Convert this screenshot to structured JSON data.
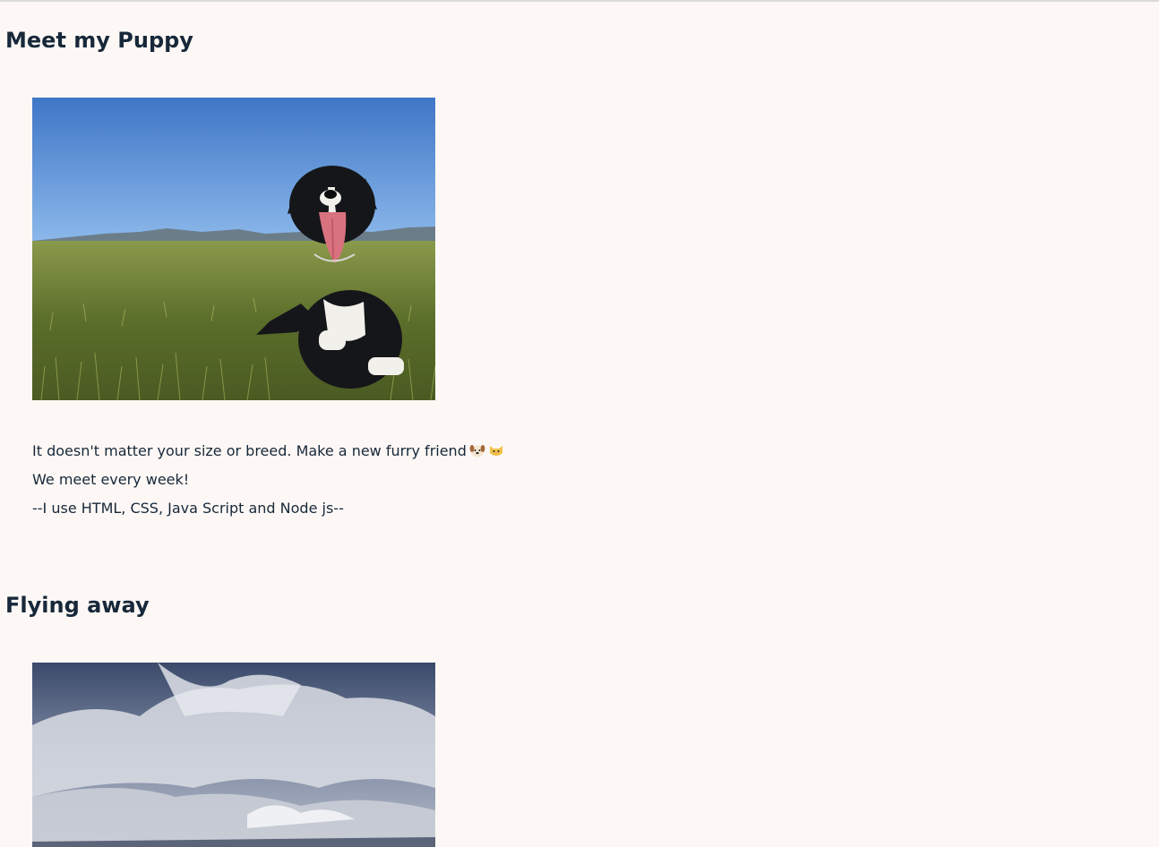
{
  "sections": [
    {
      "heading": "Meet my Puppy",
      "photo": "dog-photo",
      "paragraphs": [
        {
          "text": "It doesn't matter your size or breed. Make a new furry friend",
          "icons": [
            "dog-face-emoji",
            "cat-face-emoji"
          ]
        },
        {
          "text": "We meet every week!"
        },
        {
          "text": "--I use HTML, CSS, Java Script and Node js--"
        }
      ]
    },
    {
      "heading": "Flying away",
      "photo": "sky-photo"
    }
  ],
  "colors": {
    "background": "#fdf8f5",
    "text": "#17283a"
  }
}
